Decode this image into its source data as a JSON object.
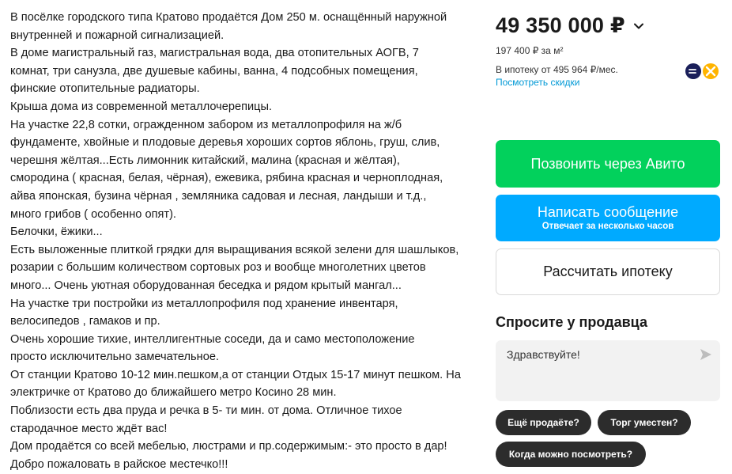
{
  "description": {
    "lines": [
      "В посёлке городского типа Кратово продаётся Дом 250 м. оснащённый наружной",
      "внутренней и пожарной сигнализацией.",
      "В доме магистральный газ, магистральная вода, два отопительных АОГВ, 7",
      "комнат, три санузла, две душевые кабины, ванна, 4 подсобных помещения,",
      "финские отопительные радиаторы.",
      "Крыша дома из современной металлочерепицы.",
      "На участке 22,8 сотки, огражденном забором из металлопрофиля на ж/б",
      "фундаменте, хвойные и плодовые деревья хороших сортов яблонь, груш, слив,",
      "черешня жёлтая...Есть лимонник китайский, малина (красная и жёлтая),",
      "смородина ( красная, белая, чёрная), ежевика, рябина красная и черноплодная,",
      "айва японская, бузина чёрная , земляника садовая и лесная, ландыши и т.д.,",
      "много грибов ( особенно опят).",
      "Белочки, ёжики...",
      "Есть выложенные плиткой грядки для выращивания всякой зелени для шашлыков,",
      "розарии с большим количеством сортовых роз и вообще многолетних цветов",
      "много... Очень уютная оборудованная беседка и рядом крытый мангал...",
      "На участке три постройки из металлопрофиля под хранение инвентаря,",
      "велосипедов , гамаков и пр.",
      "Очень хорошие тихие, интеллигентные соседи, да и само местоположение",
      "просто исключительно замечательное.",
      "От станции Кратово 10-12 мин.пешком,а от станции Отдых 15-17 минут пешком. На",
      "электричке от Кратово до ближайшего метро Косино 28 мин.",
      "Поблизости есть два пруда и речка в 5- ти мин. от дома. Отличное тихое",
      "стародачное место ждёт вас!",
      "Дом продаётся со всей мебелью, люстрами и пр.содержимым:- это просто в дар!",
      "Добро пожаловать в райское местечко!!!"
    ]
  },
  "price": {
    "value": "49 350 000 ₽",
    "per_m2": "197 400 ₽ за м²",
    "mortgage": "В ипотеку от 495 964 ₽/мес.",
    "discounts_link": "Посмотреть скидки"
  },
  "actions": {
    "call": "Позвонить через Авито",
    "message": "Написать сообщение",
    "message_sub": "Отвечает за несколько часов",
    "mortgage_calc": "Рассчитать ипотеку"
  },
  "ask_seller": {
    "title": "Спросите у продавца",
    "input_value": "Здравствуйте!",
    "chips": [
      "Ещё продаёте?",
      "Торг уместен?",
      "Когда можно посмотреть?"
    ]
  },
  "colors": {
    "call_button": "#02d15c",
    "message_button": "#00aaff",
    "link": "#0099d6",
    "chip": "#2c2c2c"
  },
  "icons": {
    "price_toggle": "chevron-down-icon",
    "bank": "bank-logo-icon",
    "send": "send-icon"
  }
}
